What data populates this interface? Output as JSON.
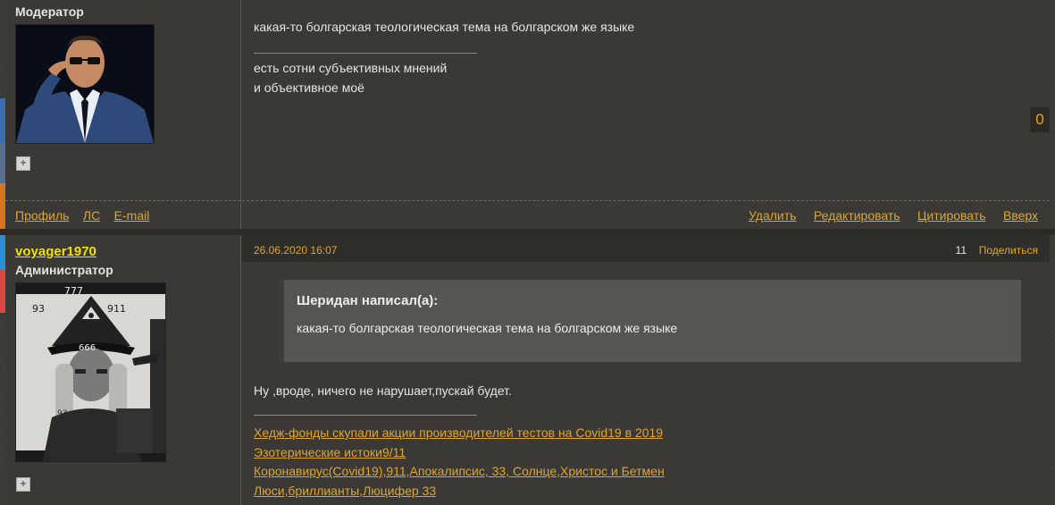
{
  "post1": {
    "role": "Модератор",
    "text_line1": "какая-то болгарская теологическая тема на болгарском же языке",
    "sig_line1": "есть сотни субъективных мнений",
    "sig_line2": "и объективное моё",
    "rating": "0",
    "plus_label": "+",
    "footer_left": [
      "Профиль",
      "ЛС",
      "E-mail"
    ],
    "footer_right": [
      "Удалить",
      "Редактировать",
      "Цитировать",
      "Вверх"
    ]
  },
  "post2": {
    "username": "voyager1970",
    "role": "Администратор",
    "date": "26.06.2020 16:07",
    "number": "11",
    "share_label": "Поделиться",
    "quote_author": "Шеридан написал(а):",
    "quote_text": "какая-то болгарская теологическая тема на болгарском же языке",
    "text": "Ну ,вроде, ничего не нарушает,пускай будет.",
    "plus_label": "+",
    "sig_links": [
      "Хедж-фонды скупали акции производителей тестов на Covid19 в 2019",
      "Эзотерические истоки9/11",
      "Коронавирус(Covid19),911,Апокалипсис, 33, Солнце,Христос и Бетмен",
      "Люси,бриллианты,Люцифер 33"
    ]
  },
  "colors": {
    "accent_link": "#e0a52a",
    "username": "#f2e000",
    "background": "#3a3936",
    "quote_bg": "#565552",
    "strip_blue": "#3b6cb0",
    "strip_orange": "#d8741c",
    "strip_lightblue": "#2a8fd4",
    "strip_red": "#d9493f"
  }
}
